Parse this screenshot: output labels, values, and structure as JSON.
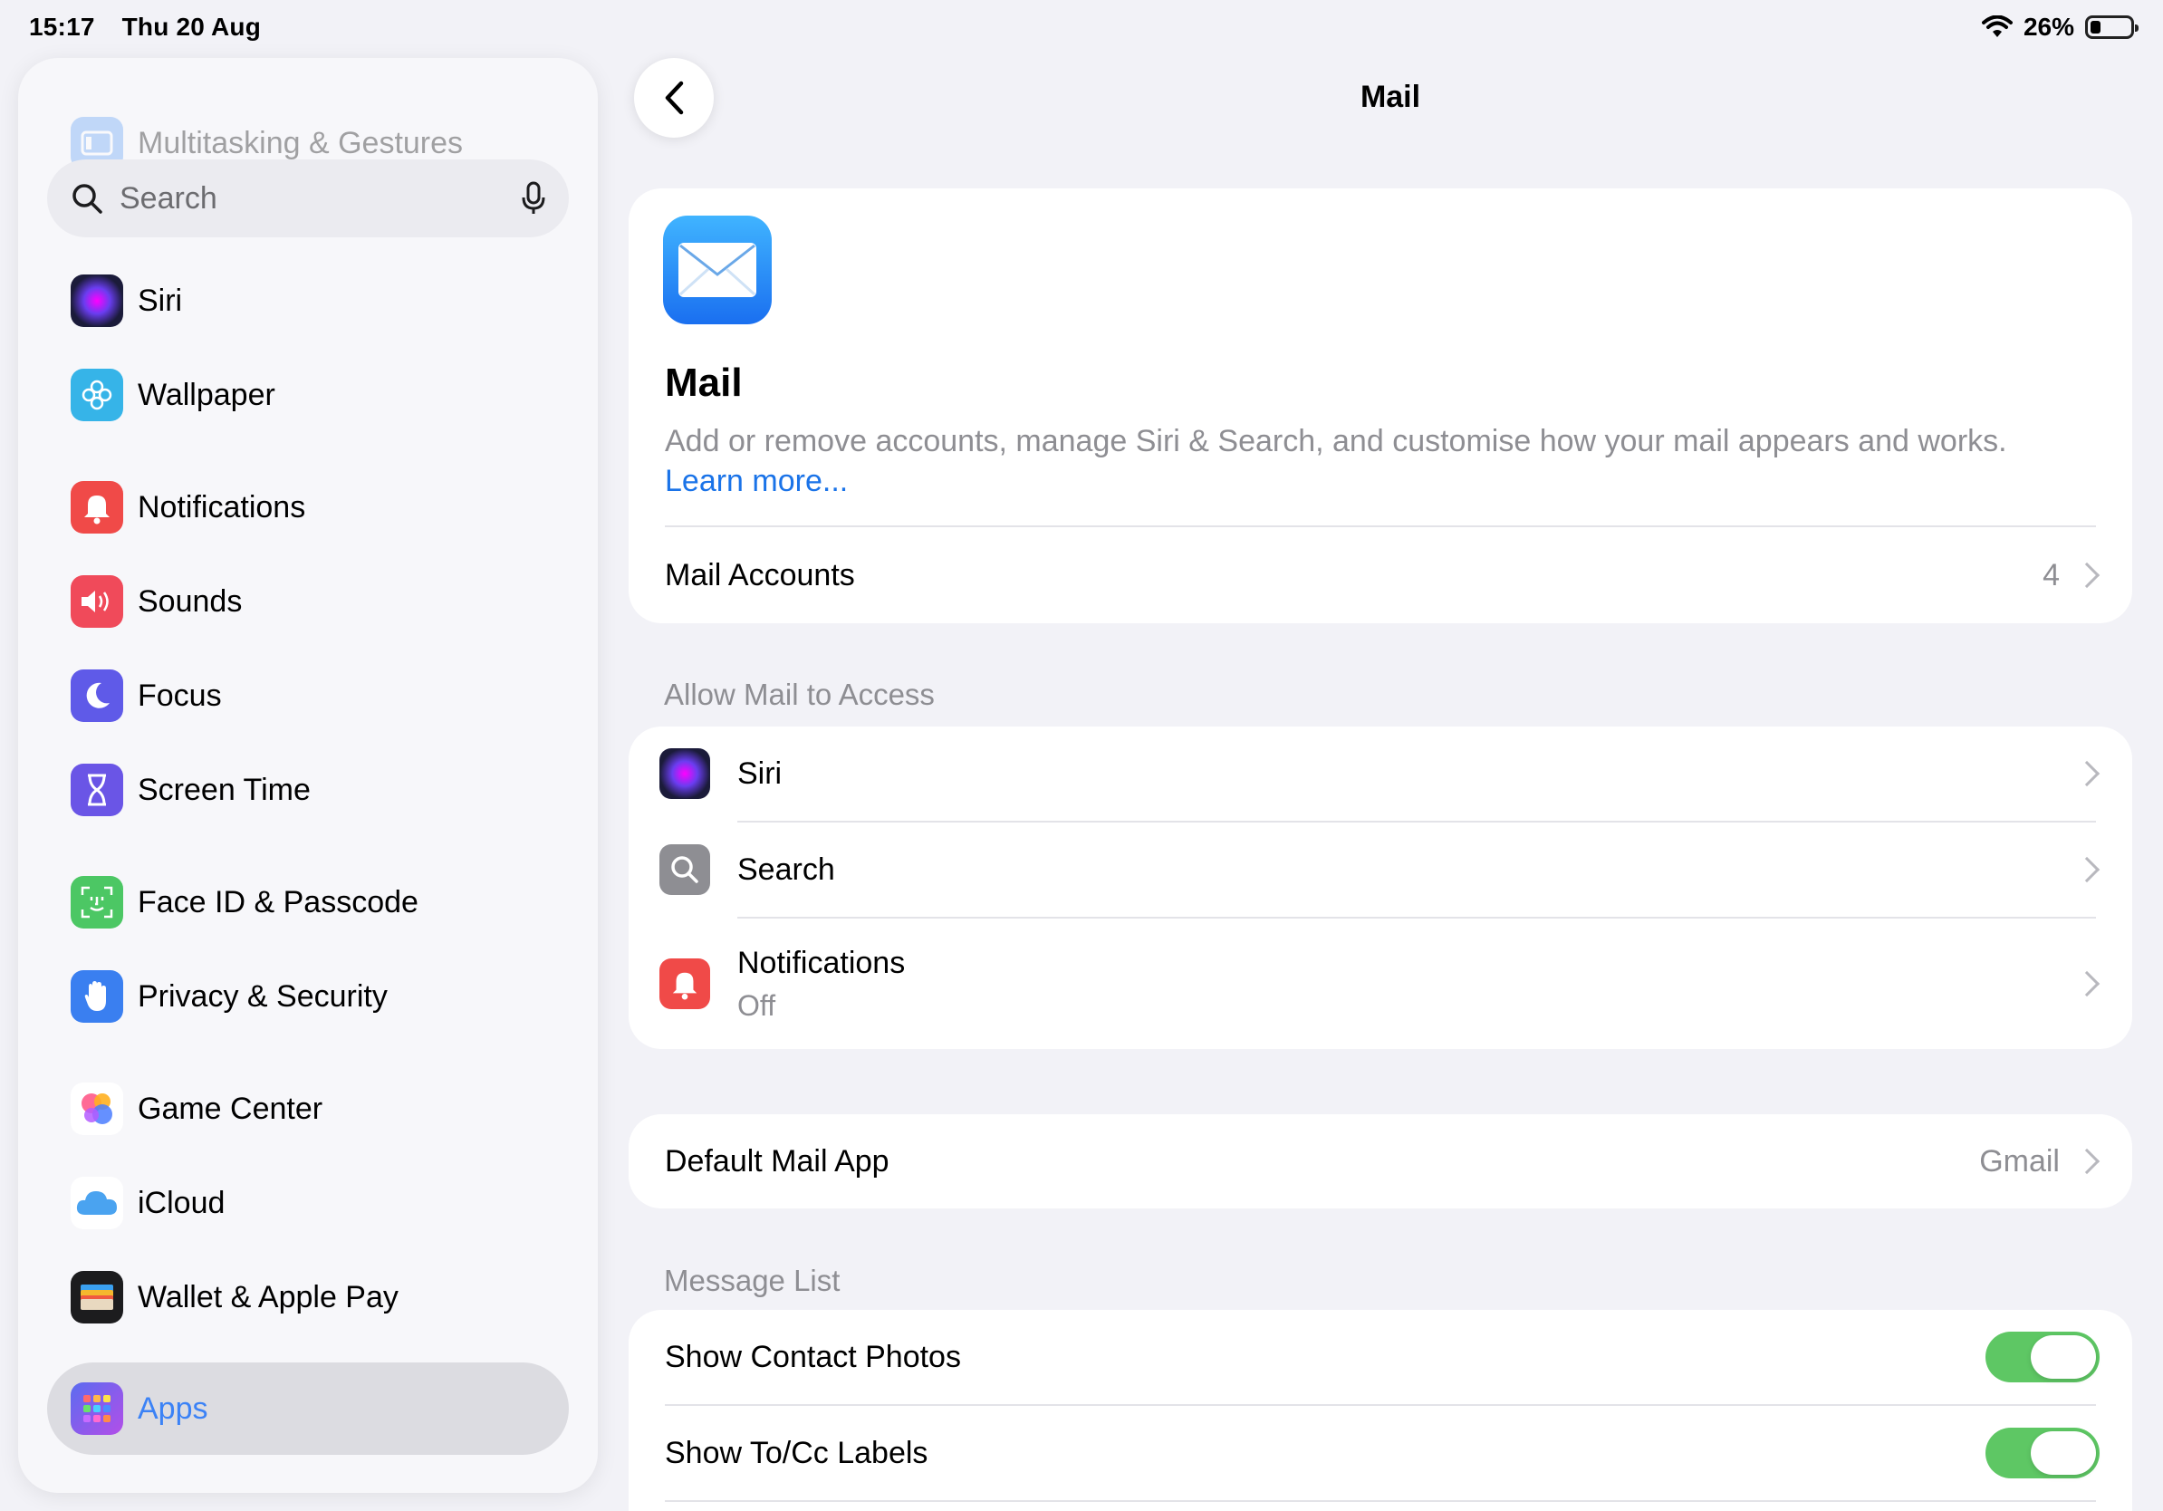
{
  "status_bar": {
    "time": "15:17",
    "date": "Thu 20 Aug",
    "battery": "26%"
  },
  "sidebar": {
    "faded_item": "Multitasking & Gestures",
    "search_placeholder": "Search",
    "items": [
      {
        "label": "Siri",
        "icon": "siri-icon"
      },
      {
        "label": "Wallpaper",
        "icon": "wallpaper-icon"
      },
      {
        "label": "Notifications",
        "icon": "notifications-icon"
      },
      {
        "label": "Sounds",
        "icon": "sounds-icon"
      },
      {
        "label": "Focus",
        "icon": "focus-icon"
      },
      {
        "label": "Screen Time",
        "icon": "screen-time-icon"
      },
      {
        "label": "Face ID & Passcode",
        "icon": "face-id-icon"
      },
      {
        "label": "Privacy & Security",
        "icon": "privacy-icon"
      },
      {
        "label": "Game Center",
        "icon": "game-center-icon"
      },
      {
        "label": "iCloud",
        "icon": "icloud-icon"
      },
      {
        "label": "Wallet & Apple Pay",
        "icon": "wallet-icon"
      },
      {
        "label": "Apps",
        "icon": "apps-icon",
        "selected": true
      }
    ]
  },
  "detail": {
    "nav_title": "Mail",
    "header": {
      "title": "Mail",
      "description": "Add or remove accounts, manage Siri & Search, and customise how your mail appears and works.",
      "learn_more": "Learn more..."
    },
    "mail_accounts": {
      "label": "Mail Accounts",
      "value": "4"
    },
    "allow_access": {
      "header": "Allow Mail to Access",
      "items": [
        {
          "label": "Siri"
        },
        {
          "label": "Search"
        },
        {
          "label": "Notifications",
          "sub": "Off"
        }
      ]
    },
    "default_app": {
      "label": "Default Mail App",
      "value": "Gmail"
    },
    "message_list": {
      "header": "Message List",
      "items": [
        {
          "label": "Show Contact Photos",
          "on": true
        },
        {
          "label": "Show To/Cc Labels",
          "on": true
        }
      ]
    }
  },
  "colors": {
    "accent": "#3b82f6",
    "toggle_on": "#5ec764"
  }
}
